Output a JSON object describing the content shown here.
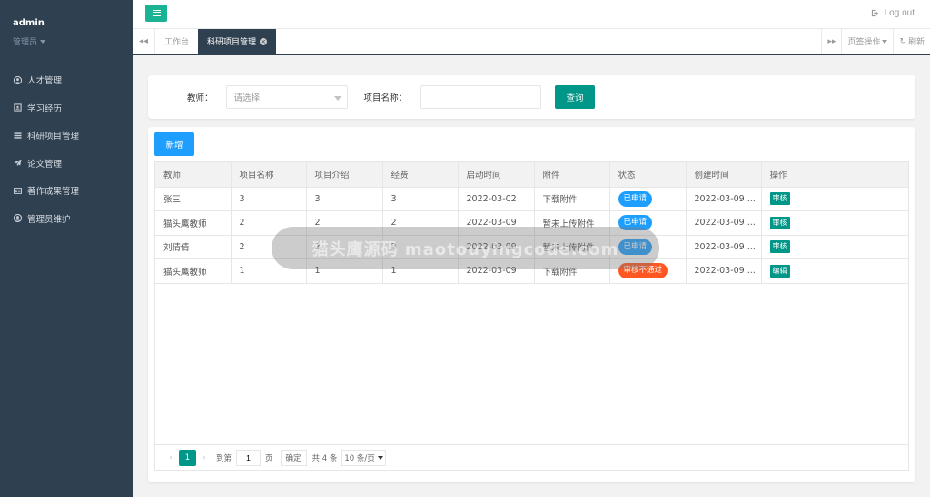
{
  "sidebar": {
    "user_name": "admin",
    "user_role": "管理员",
    "items": [
      {
        "label": "人才管理",
        "icon": "user-circle-icon"
      },
      {
        "label": "学习经历",
        "icon": "id-card-icon"
      },
      {
        "label": "科研项目管理",
        "icon": "list-icon"
      },
      {
        "label": "论文管理",
        "icon": "paper-plane-icon"
      },
      {
        "label": "著作成果管理",
        "icon": "address-card-icon"
      },
      {
        "label": "管理员维护",
        "icon": "user-circle-icon"
      }
    ]
  },
  "topbar": {
    "logout_label": "Log out"
  },
  "tabs": {
    "home": "工作台",
    "active": "科研项目管理",
    "page_ops": "页签操作",
    "refresh": "刷新"
  },
  "search": {
    "teacher_label": "教师：",
    "teacher_placeholder": "请选择",
    "project_label": "项目名称：",
    "project_value": "",
    "query_button": "查询"
  },
  "toolbar": {
    "add_button": "新增"
  },
  "table": {
    "columns": [
      "教师",
      "项目名称",
      "项目介绍",
      "经费",
      "启动时间",
      "附件",
      "状态",
      "创建时间",
      "操作"
    ],
    "rows": [
      {
        "teacher": "张三",
        "name": "3",
        "intro": "3",
        "fund": "3",
        "start": "2022-03-02",
        "attach": "下载附件",
        "status": "已申请",
        "status_color": "#1e9fff",
        "created": "2022-03-09 ...",
        "op": "审核"
      },
      {
        "teacher": "猫头鹰教师",
        "name": "2",
        "intro": "2",
        "fund": "2",
        "start": "2022-03-09",
        "attach": "暂未上传附件",
        "status": "已申请",
        "status_color": "#1e9fff",
        "created": "2022-03-09 ...",
        "op": "审核"
      },
      {
        "teacher": "刘倩倩",
        "name": "2",
        "intro": "2",
        "fund": "2",
        "start": "2022-03-09",
        "attach": "暂未上传附件",
        "status": "已申请",
        "status_color": "#1e9fff",
        "created": "2022-03-09 ...",
        "op": "审核"
      },
      {
        "teacher": "猫头鹰教师",
        "name": "1",
        "intro": "1",
        "fund": "1",
        "start": "2022-03-09",
        "attach": "下载附件",
        "status": "审核不通过",
        "status_color": "#ff5722",
        "created": "2022-03-09 ...",
        "op": "编辑"
      }
    ]
  },
  "pager": {
    "current": "1",
    "goto_label": "到第",
    "goto_value": "1",
    "page_unit": "页",
    "confirm": "确定",
    "total": "共 4 条",
    "page_size": "10 条/页"
  },
  "watermark": "猫头鹰源码 maotouyingcode.com"
}
